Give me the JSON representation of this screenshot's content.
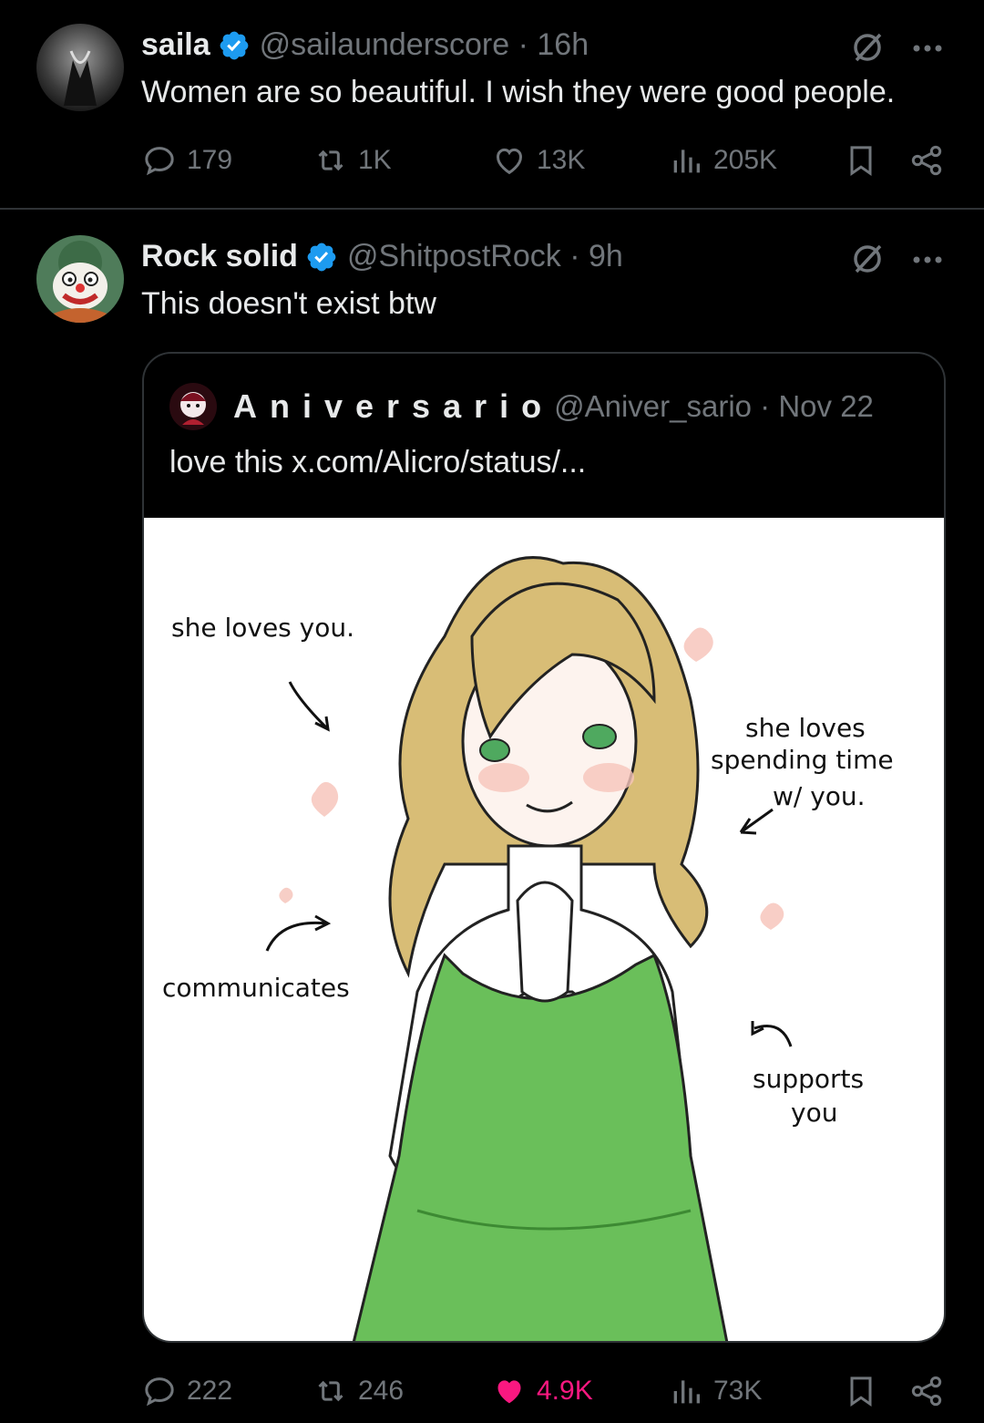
{
  "tweet1": {
    "name": "saila",
    "handle_time": "@sailaunderscore · 16h",
    "text": "Women are so beautiful. I wish they were good people.",
    "replies": "179",
    "reposts": "1K",
    "likes": "13K",
    "views": "205K"
  },
  "tweet2": {
    "name": "Rock solid",
    "handle_time": "@ShitpostRock · 9h",
    "text": "This doesn't exist btw",
    "replies": "222",
    "reposts": "246",
    "likes": "4.9K",
    "views": "73K",
    "liked": true
  },
  "quote": {
    "name": "Aniversario",
    "handle_time": "@Aniver_sario · Nov 22",
    "text": "love this  x.com/Alicro/status/...",
    "image": {
      "annotation_1": "she loves you.",
      "annotation_2_line1": "she loves",
      "annotation_2_line2": "spending time",
      "annotation_2_line3": "w/ you.",
      "annotation_3": "communicates",
      "annotation_4_line1": "supports",
      "annotation_4_line2": "you"
    }
  },
  "colors": {
    "background": "#000000",
    "text": "#e7e9ea",
    "muted": "#71767b",
    "verified": "#1d9bf0",
    "like_active": "#f91880",
    "divider": "#2f3336"
  }
}
